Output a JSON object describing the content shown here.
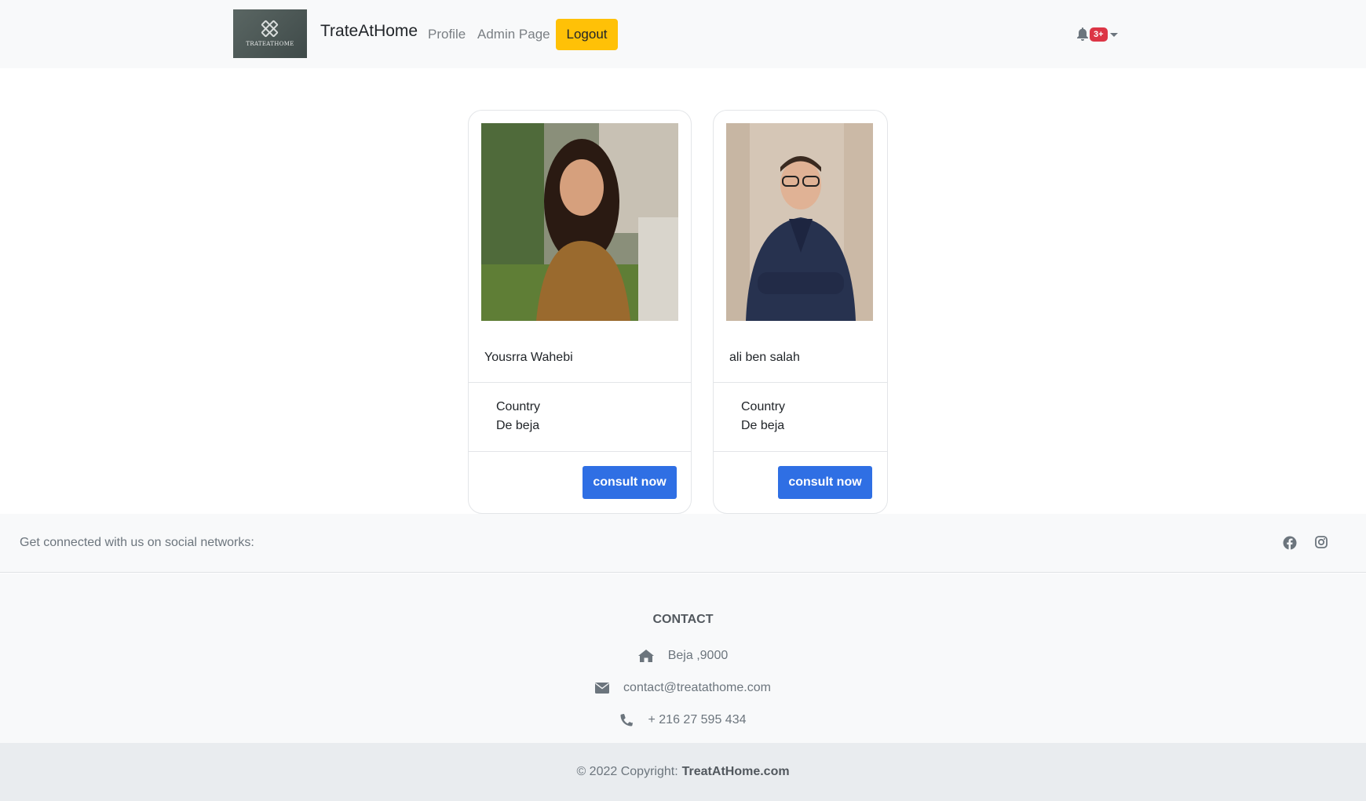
{
  "navbar": {
    "logo_text": "TRATEATHOME",
    "brand": "TrateAtHome",
    "links": {
      "profile": "Profile",
      "admin": "Admin Page"
    },
    "logout_label": "Logout",
    "notification_badge": "3+"
  },
  "doctors": [
    {
      "name": "Yousrra Wahebi",
      "country_label": "Country",
      "country_value": "De beja",
      "button_label": "consult now"
    },
    {
      "name": "ali ben salah",
      "country_label": "Country",
      "country_value": "De beja",
      "button_label": "consult now"
    }
  ],
  "footer": {
    "social_text": "Get connected with us on social networks:",
    "social_icons": [
      "facebook-icon",
      "instagram-icon"
    ],
    "contact_title": "CONTACT",
    "address": "Beja ,9000",
    "email": "contact@treatathome.com",
    "phone": "+ 216 27 595 434",
    "copyright_prefix": "© 2022 Copyright:",
    "copyright_link": "TreatAtHome.com"
  },
  "colors": {
    "navbar_bg": "#f8f9fa",
    "logout_bg": "#ffc107",
    "badge_bg": "#dc3545",
    "primary_button": "#2f6fe4",
    "copyright_bg": "#e9ecef"
  }
}
